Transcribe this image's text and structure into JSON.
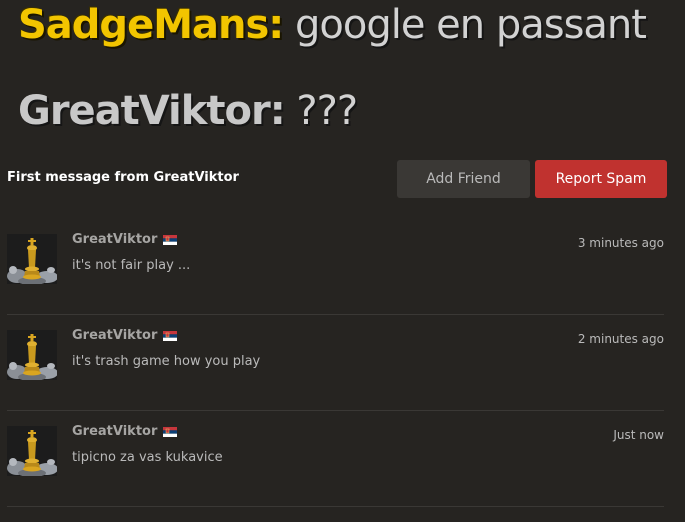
{
  "overlay_chat": [
    {
      "user": "SadgeMans:",
      "message": " google en passant",
      "user_color": "#f2c500"
    },
    {
      "user": "GreatViktor:",
      "message": " ???",
      "user_color": "#c8c8c8"
    }
  ],
  "conversation": {
    "title": "First message from GreatViktor",
    "add_friend_label": "Add Friend",
    "report_spam_label": "Report Spam"
  },
  "messages": [
    {
      "user": "GreatViktor",
      "flag": "serbia-flag-icon",
      "time": "3 minutes ago",
      "text": "it's not fair play ..."
    },
    {
      "user": "GreatViktor",
      "flag": "serbia-flag-icon",
      "time": "2 minutes ago",
      "text": "it's trash game how you play"
    },
    {
      "user": "GreatViktor",
      "flag": "serbia-flag-icon",
      "time": "Just now",
      "text": "tipicno za vas kukavice"
    }
  ],
  "colors": {
    "background": "#262421",
    "report_spam": "#c0322f",
    "add_friend": "#3a3835"
  }
}
